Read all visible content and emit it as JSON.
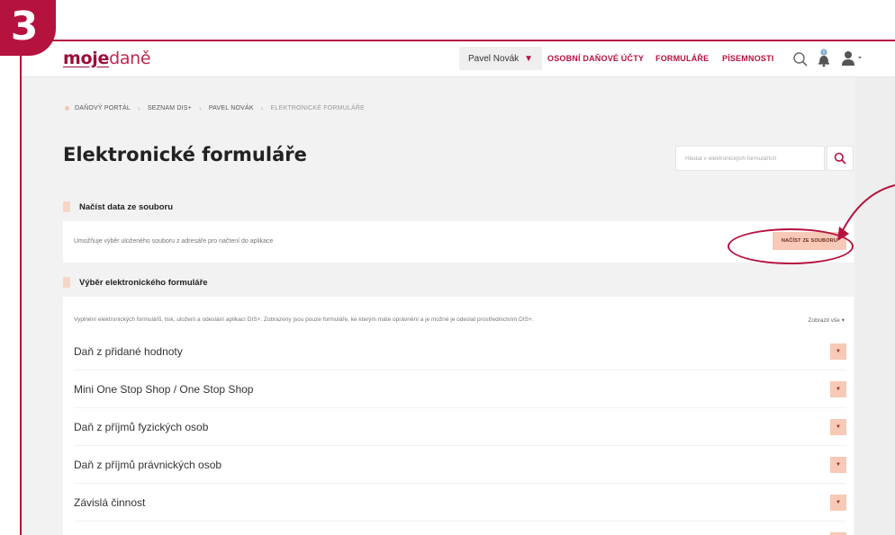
{
  "step": {
    "number": "3"
  },
  "header": {
    "logo_prefix": "moje",
    "logo_suffix": "daně",
    "user_name": "Pavel Novák",
    "nav": [
      "OSOBNÍ DAŇOVÉ ÚČTY",
      "FORMULÁŘE",
      "PÍSEMNOSTI"
    ],
    "notification_count": "0"
  },
  "breadcrumb": [
    "DAŇOVÝ PORTÁL",
    "SEZNAM DIS+",
    "PAVEL NOVÁK",
    "ELEKTRONICKÉ FORMULÁŘE"
  ],
  "page": {
    "title": "Elektronické formuláře",
    "search_placeholder": "Hledat v elektronických formulářích"
  },
  "load_section": {
    "title": "Načíst data ze souboru",
    "description": "Umožňuje výběr uloženého souboru z adresáře pro načtení do aplikace",
    "button_label": "NAČÍST ZE SOUBORU"
  },
  "forms_section": {
    "title": "Výběr elektronického formuláře",
    "description": "Vyplnění elektronických formulářů, tisk, uložení a odeslání aplikací DIS+. Zobrazeny jsou pouze formuláře, ke kterým máte oprávnění a je možné je odeslat prostřednictvím DIS+.",
    "show_all": "Zobrazit vše",
    "items": [
      "Daň z přidané hodnoty",
      "Mini One Stop Shop / One Stop Shop",
      "Daň z příjmů fyzických osob",
      "Daň z příjmů právnických osob",
      "Závislá činnost"
    ]
  },
  "colors": {
    "accent": "#b5123e",
    "button": "#f7c9b6",
    "background": "#f2f2f2"
  }
}
